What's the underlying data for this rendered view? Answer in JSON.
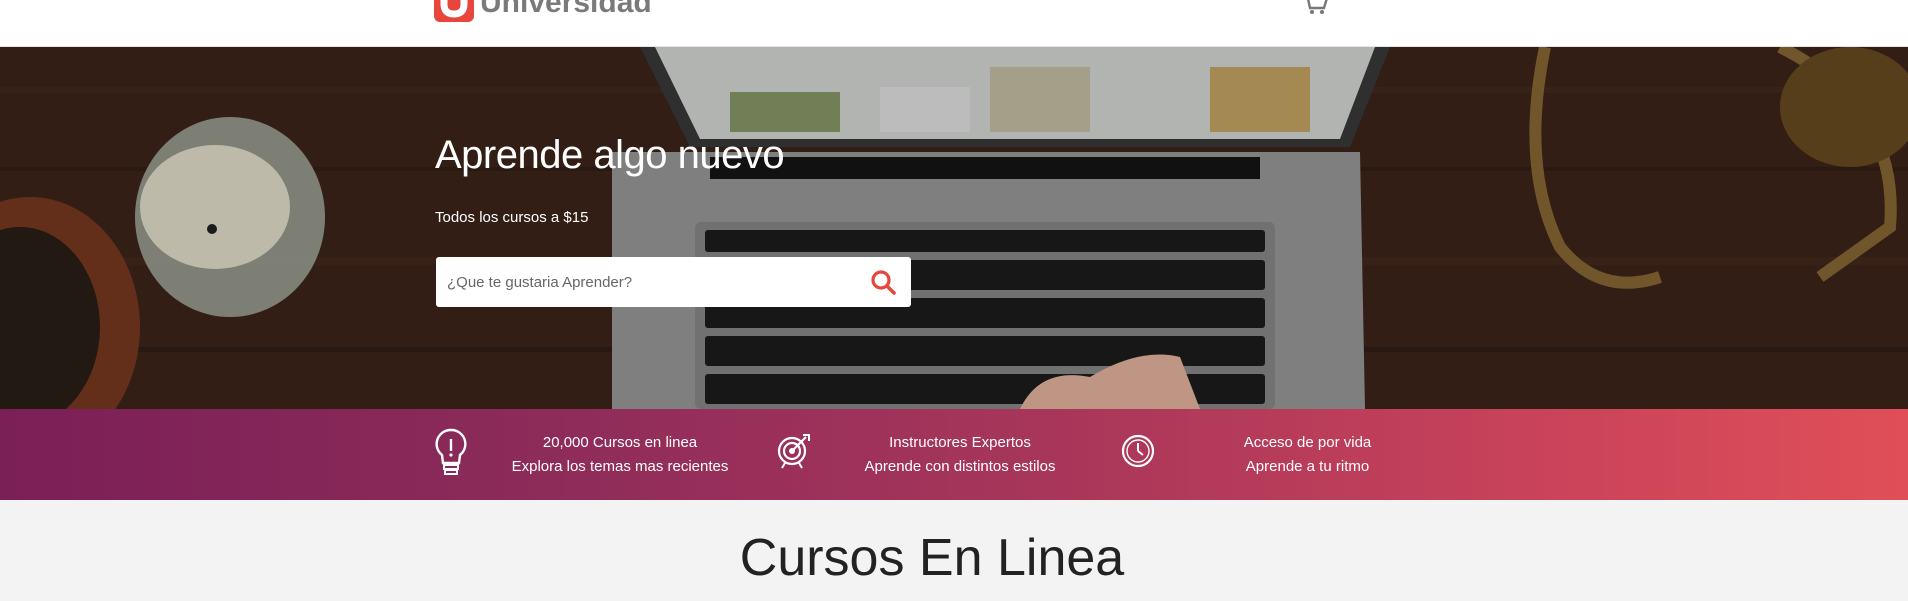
{
  "header": {
    "logo_text": "Universidad",
    "cart_icon": "cart-icon"
  },
  "hero": {
    "title": "Aprende algo nuevo",
    "subtitle": "Todos los cursos a $15",
    "search": {
      "placeholder": "¿Que te gustaria Aprender?",
      "icon": "search-icon"
    }
  },
  "features": [
    {
      "icon": "lightbulb-icon",
      "line1": "20,000 Cursos en linea",
      "line2": "Explora los temas mas recientes"
    },
    {
      "icon": "target-icon",
      "line1": "Instructores Expertos",
      "line2": "Aprende con distintos estilos"
    },
    {
      "icon": "clock-icon",
      "line1": "Acceso de por vida",
      "line2": "Aprende a tu ritmo"
    }
  ],
  "section": {
    "title": "Cursos En Linea"
  },
  "colors": {
    "brand": "#e8453c",
    "band_start": "#7b1f57",
    "band_end": "#e04f58"
  }
}
